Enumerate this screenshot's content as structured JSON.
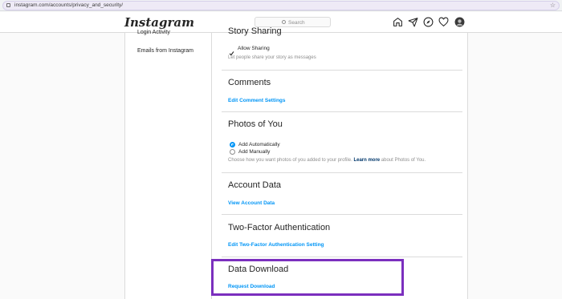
{
  "browser": {
    "url": "instagram.com/accounts/privacy_and_security/"
  },
  "header": {
    "logo": "Instagram",
    "search_placeholder": "Search"
  },
  "sidebar": {
    "items": [
      "Login Activity",
      "Emails from Instagram"
    ]
  },
  "story_sharing": {
    "title": "Story Sharing",
    "checkbox_label": "Allow Sharing",
    "checked": true,
    "hint": "Let people share your story as messages"
  },
  "comments": {
    "title": "Comments",
    "link": "Edit Comment Settings"
  },
  "photos_of_you": {
    "title": "Photos of You",
    "options": [
      "Add Automatically",
      "Add Manually"
    ],
    "selected": "Add Automatically",
    "hint_before": "Choose how you want photos of you added to your profile. ",
    "learn_more": "Learn more",
    "hint_after": " about Photos of You."
  },
  "account_data": {
    "title": "Account Data",
    "link": "View Account Data"
  },
  "two_factor": {
    "title": "Two-Factor Authentication",
    "link": "Edit Two-Factor Authentication Setting"
  },
  "data_download": {
    "title": "Data Download",
    "link": "Request Download"
  },
  "colors": {
    "link": "#0095f6",
    "highlight": "#7b2fbe",
    "text": "#262626",
    "muted": "#8e8e8e"
  }
}
